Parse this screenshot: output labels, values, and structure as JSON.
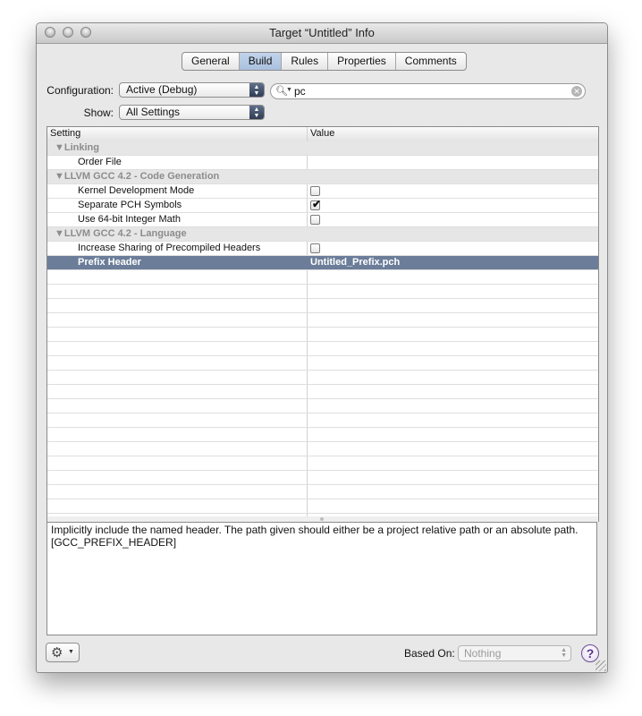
{
  "window": {
    "title": "Target “Untitled” Info"
  },
  "tabs": [
    "General",
    "Build",
    "Rules",
    "Properties",
    "Comments"
  ],
  "selected_tab": "Build",
  "configuration": {
    "label": "Configuration:",
    "value": "Active (Debug)"
  },
  "show": {
    "label": "Show:",
    "value": "All Settings"
  },
  "search": {
    "value": "pc"
  },
  "table": {
    "headers": {
      "setting": "Setting",
      "value": "Value"
    },
    "groups": [
      {
        "title": "▼Linking",
        "rows": [
          {
            "setting": "Order File",
            "value": ""
          }
        ]
      },
      {
        "title": "▼LLVM GCC 4.2 - Code Generation",
        "rows": [
          {
            "setting": "Kernel Development Mode",
            "checked": false
          },
          {
            "setting": "Separate PCH Symbols",
            "checked": true
          },
          {
            "setting": "Use 64-bit Integer Math",
            "checked": false
          }
        ]
      },
      {
        "title": "▼LLVM GCC 4.2 - Language",
        "rows": [
          {
            "setting": "Increase Sharing of Precompiled Headers",
            "checked": false
          },
          {
            "setting": "Prefix Header",
            "value": "Untitled_Prefix.pch",
            "selected": true
          }
        ]
      }
    ]
  },
  "description": {
    "line1": "Implicitly include the named header. The path given should either be a project relative path or an absolute path.",
    "line2": "[GCC_PREFIX_HEADER]"
  },
  "footer": {
    "based_on_label": "Based On:",
    "based_on_value": "Nothing",
    "help_label": "?"
  },
  "icons": {
    "gear": "gear-icon",
    "help": "help-icon",
    "search": "search-icon",
    "clear": "clear-icon"
  },
  "colors": {
    "selection": "#6b7d99",
    "tab_selected": "#b8cbe5",
    "help": "#5b2f8d"
  }
}
